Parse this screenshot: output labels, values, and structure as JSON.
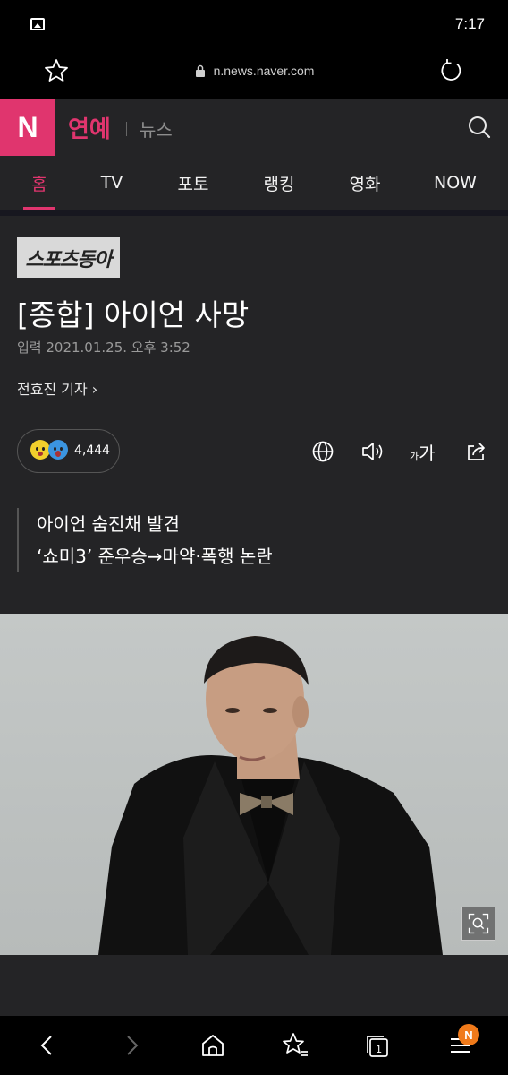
{
  "status_bar": {
    "time": "7:17"
  },
  "url_bar": {
    "url": "n.news.naver.com"
  },
  "header": {
    "logo": "N",
    "section": "연예",
    "subsection": "뉴스"
  },
  "tabs": [
    {
      "label": "홈",
      "active": true
    },
    {
      "label": "TV"
    },
    {
      "label": "포토"
    },
    {
      "label": "랭킹"
    },
    {
      "label": "영화"
    },
    {
      "label": "NOW"
    }
  ],
  "article": {
    "press": "스포츠동아",
    "headline": "[종합] 아이언 사망",
    "date": "입력 2021.01.25. 오후 3:52",
    "reporter": "전효진 기자 ›",
    "reaction_count": "4,444",
    "font_small": "가",
    "font_big": "가",
    "summary": [
      "아이언 숨진채 발견",
      "‘쇼미3’ 준우승→마약·폭행 논란"
    ]
  },
  "bottom_nav": {
    "tabs_count": "1",
    "badge": "N"
  },
  "colors": {
    "accent": "#e0356e",
    "header_bg": "#242426",
    "badge": "#f07a1a"
  }
}
